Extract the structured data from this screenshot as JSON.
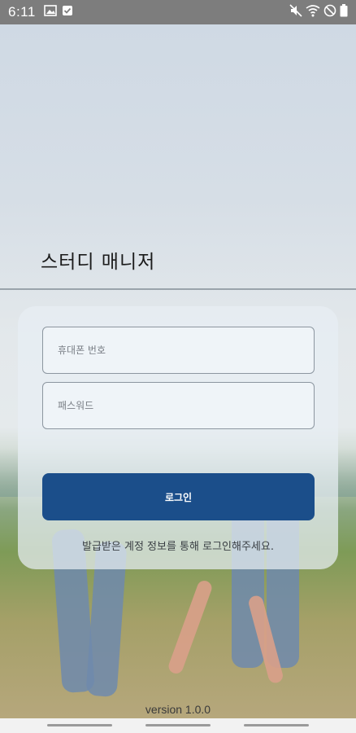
{
  "status_bar": {
    "time": "6:11",
    "left_icons": [
      "image-icon",
      "check-box-icon"
    ],
    "right_icons": [
      "mute-icon",
      "wifi-icon",
      "dnd-icon",
      "battery-icon"
    ]
  },
  "app": {
    "title": "스터디 매니저",
    "phone_placeholder": "휴대폰 번호",
    "password_placeholder": "패스워드",
    "login_label": "로그인",
    "hint": "발급받은 계정 정보를 통해 로그인해주세요.",
    "version": "version 1.0.0"
  },
  "colors": {
    "primary_button": "#1b4e8a",
    "status_bar": "#7d7d7d"
  }
}
